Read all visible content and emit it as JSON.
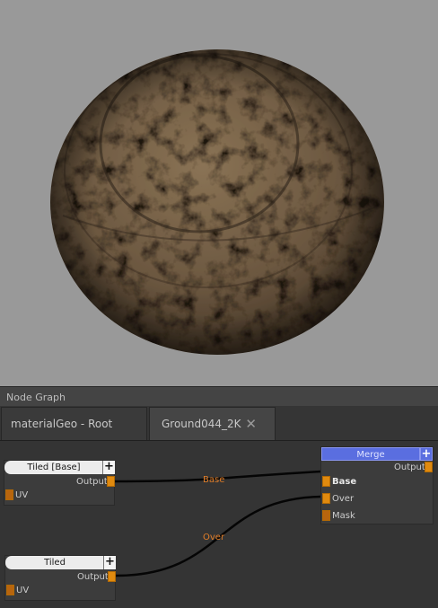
{
  "panel": {
    "title": "Node Graph"
  },
  "tabs": [
    {
      "label": "materialGeo - Root"
    },
    {
      "label": "Ground044_2K",
      "close_icon": "✕"
    }
  ],
  "nodes": {
    "tiled_base": {
      "title": "Tiled [Base]",
      "plus": "+",
      "output_label": "Output",
      "input_label": "UV"
    },
    "tiled_over": {
      "title": "Tiled",
      "plus": "+",
      "output_label": "Output",
      "input_label": "UV"
    },
    "merge": {
      "title": "Merge",
      "plus": "+",
      "output_label": "Output",
      "inputs": [
        "Base",
        "Over",
        "Mask"
      ]
    }
  },
  "wires": {
    "base_label": "Base",
    "over_label": "Over"
  },
  "colors": {
    "viewport_bg": "#999999",
    "port": "#e08a0f",
    "wire_label": "#e07d28",
    "merge_header": "#5a6ee0"
  }
}
